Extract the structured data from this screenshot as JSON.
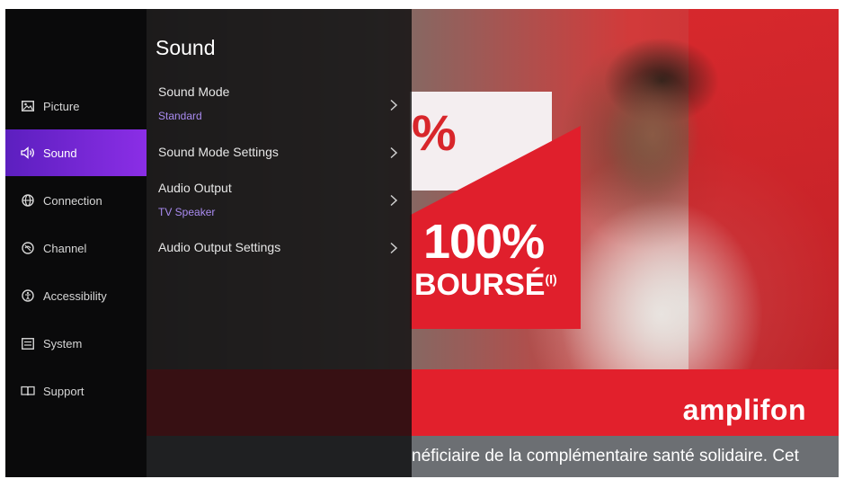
{
  "background": {
    "white_card_text": "%",
    "red_card_percent": "100%",
    "red_card_text": "BOURSÉ",
    "red_card_sup": "(I)",
    "brand": "amplifon",
    "ticker": "néficiaire de la complémentaire santé solidaire. Cet"
  },
  "nav": {
    "items": [
      {
        "label": "Picture",
        "icon": "picture-icon"
      },
      {
        "label": "Sound",
        "icon": "sound-icon",
        "active": true
      },
      {
        "label": "Connection",
        "icon": "globe-icon"
      },
      {
        "label": "Channel",
        "icon": "channel-icon"
      },
      {
        "label": "Accessibility",
        "icon": "accessibility-icon"
      },
      {
        "label": "System",
        "icon": "system-icon"
      },
      {
        "label": "Support",
        "icon": "support-icon"
      }
    ]
  },
  "panel": {
    "title": "Sound",
    "rows": [
      {
        "label": "Sound Mode",
        "value": "Standard"
      },
      {
        "label": "Sound Mode Settings"
      },
      {
        "label": "Audio Output",
        "value": "TV Speaker"
      },
      {
        "label": "Audio Output Settings"
      }
    ]
  },
  "colors": {
    "accent_start": "#5c1fbf",
    "accent_end": "#8b2ee6",
    "value_text": "#a98bf0",
    "brand_red": "#e2202c"
  }
}
